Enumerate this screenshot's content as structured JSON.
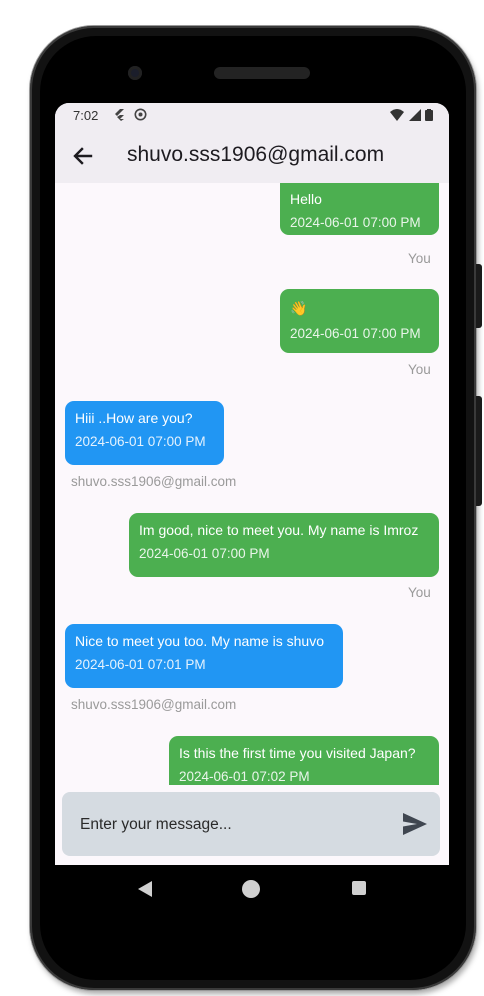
{
  "status_bar": {
    "time": "7:02",
    "left_icons": [
      "flutter-icon",
      "face-icon"
    ],
    "right_icons": [
      "wifi-icon",
      "signal-icon",
      "battery-icon"
    ]
  },
  "app_bar": {
    "title": "shuvo.sss1906@gmail.com",
    "back_icon": "arrow-left-icon"
  },
  "messages": [
    {
      "side": "sent",
      "text": "Hello",
      "time": "2024-06-01 07:00 PM",
      "sender": "You"
    },
    {
      "side": "sent",
      "text": "👋",
      "time": "2024-06-01 07:00 PM",
      "sender": "You"
    },
    {
      "side": "recv",
      "text": "Hiii ..How are you?",
      "time": "2024-06-01 07:00 PM",
      "sender": "shuvo.sss1906@gmail.com"
    },
    {
      "side": "sent",
      "text": "Im good, nice to meet you. My name is Imroz",
      "time": "2024-06-01 07:00 PM",
      "sender": "You"
    },
    {
      "side": "recv",
      "text": "Nice to meet you too. My name is shuvo",
      "time": "2024-06-01 07:01 PM",
      "sender": "shuvo.sss1906@gmail.com"
    },
    {
      "side": "sent",
      "text": "Is this the first time you visited Japan?",
      "time": "2024-06-01 07:02 PM",
      "sender": ""
    }
  ],
  "composer": {
    "placeholder": "Enter your message...",
    "send_icon": "send-icon"
  },
  "colors": {
    "sent_bubble": "#4caf50",
    "received_bubble": "#2196f3",
    "app_bar": "#f0edf2"
  }
}
